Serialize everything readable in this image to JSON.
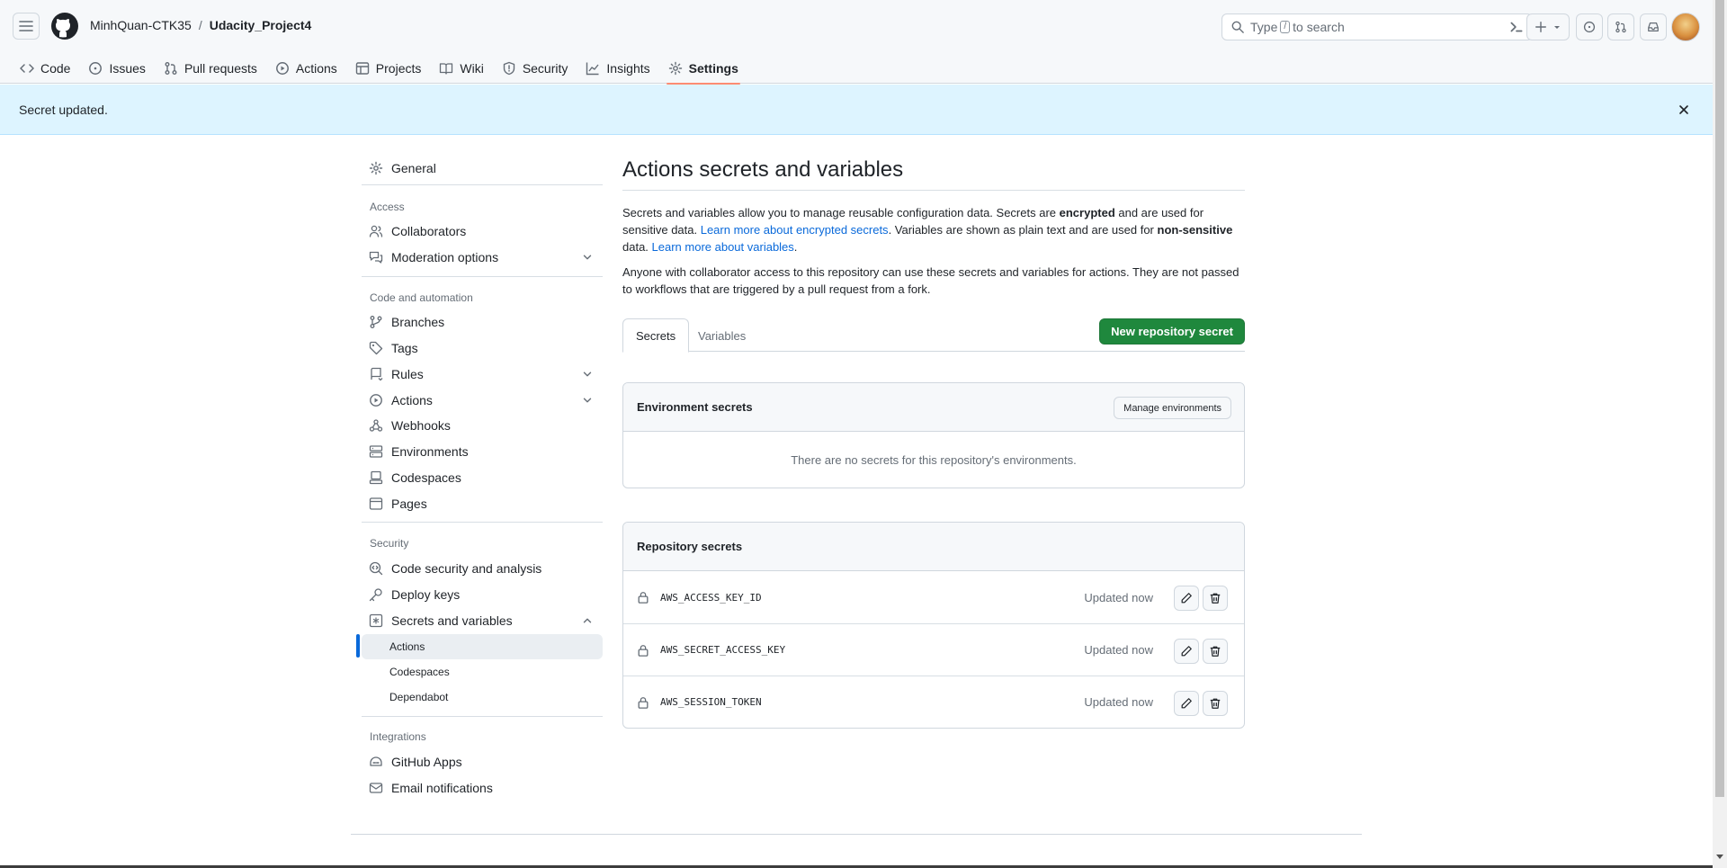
{
  "header": {
    "owner": "MinhQuan-CTK35",
    "separator": "/",
    "repo": "Udacity_Project4",
    "search": {
      "prefix": "Type",
      "key": "/",
      "suffix": "to search"
    }
  },
  "repo_tabs": [
    {
      "label": "Code",
      "icon": "code-icon"
    },
    {
      "label": "Issues",
      "icon": "issue-opened-icon"
    },
    {
      "label": "Pull requests",
      "icon": "git-pull-request-icon"
    },
    {
      "label": "Actions",
      "icon": "play-icon"
    },
    {
      "label": "Projects",
      "icon": "table-icon"
    },
    {
      "label": "Wiki",
      "icon": "book-icon"
    },
    {
      "label": "Security",
      "icon": "shield-icon"
    },
    {
      "label": "Insights",
      "icon": "graph-icon"
    },
    {
      "label": "Settings",
      "icon": "gear-icon",
      "active": true
    }
  ],
  "flash": {
    "message": "Secret updated."
  },
  "sidebar": {
    "general": "General",
    "access_heading": "Access",
    "collaborators": "Collaborators",
    "moderation": "Moderation options",
    "code_heading": "Code and automation",
    "branches": "Branches",
    "tags": "Tags",
    "rules": "Rules",
    "actions": "Actions",
    "webhooks": "Webhooks",
    "environments": "Environments",
    "codespaces": "Codespaces",
    "pages": "Pages",
    "security_heading": "Security",
    "code_security": "Code security and analysis",
    "deploy_keys": "Deploy keys",
    "secrets_vars": "Secrets and variables",
    "sub_actions": "Actions",
    "sub_codespaces": "Codespaces",
    "sub_dependabot": "Dependabot",
    "integrations_heading": "Integrations",
    "github_apps": "GitHub Apps",
    "email_notifications": "Email notifications"
  },
  "main": {
    "title": "Actions secrets and variables",
    "desc": {
      "p1": "Secrets and variables allow you to manage reusable configuration data. Secrets are ",
      "b1": "encrypted",
      "p2": " and are used for sensitive data. ",
      "link1": "Learn more about encrypted secrets",
      "p3": ". Variables are shown as plain text and are used for ",
      "b2": "non-sensitive",
      "p4": " data. ",
      "link2": "Learn more about variables",
      "p5": "."
    },
    "desc2": "Anyone with collaborator access to this repository can use these secrets and variables for actions. They are not passed to workflows that are triggered by a pull request from a fork.",
    "tab_secrets": "Secrets",
    "tab_variables": "Variables",
    "new_secret_button": "New repository secret",
    "env_secrets": {
      "title": "Environment secrets",
      "manage_button": "Manage environments",
      "empty": "There are no secrets for this repository's environments."
    },
    "repo_secrets": {
      "title": "Repository secrets",
      "rows": [
        {
          "name": "AWS_ACCESS_KEY_ID",
          "updated": "Updated now"
        },
        {
          "name": "AWS_SECRET_ACCESS_KEY",
          "updated": "Updated now"
        },
        {
          "name": "AWS_SESSION_TOKEN",
          "updated": "Updated now"
        }
      ]
    }
  },
  "colors": {
    "primary_button": "#1f883d",
    "flash_bg": "#ddf4ff",
    "active_tab_underline": "#fd8c73",
    "link": "#0969da"
  }
}
